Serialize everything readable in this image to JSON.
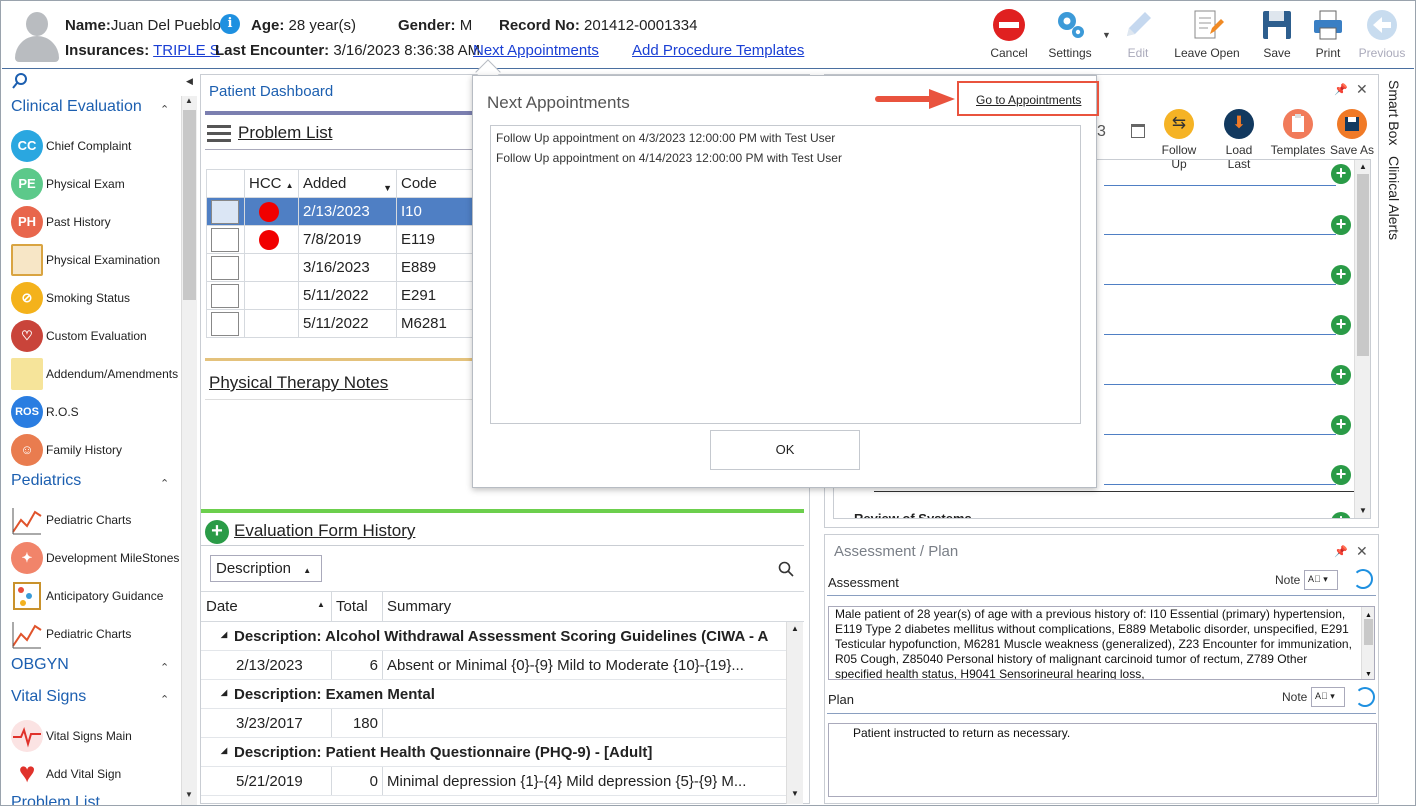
{
  "header": {
    "name_label": "Name:",
    "name_value": "Juan Del Pueblo",
    "age_label": "Age:",
    "age_value": "28 year(s)",
    "gender_label": "Gender:",
    "gender_value": "M",
    "record_label": "Record No:",
    "record_value": "201412-0001334",
    "insurances_label": "Insurances:",
    "insurances_value": "TRIPLE S",
    "last_encounter_label": "Last Encounter:",
    "last_encounter_value": "3/16/2023 8:36:38 AM",
    "next_appointments": "Next Appointments",
    "add_procedure_templates": "Add Procedure Templates"
  },
  "toolbar": {
    "cancel": "Cancel",
    "settings": "Settings",
    "edit": "Edit",
    "leave_open": "Leave Open",
    "save": "Save",
    "print": "Print",
    "previous": "Previous"
  },
  "leftnav": {
    "sections": {
      "clinical_evaluation": "Clinical Evaluation",
      "pediatrics": "Pediatrics",
      "obgyn": "OBGYN",
      "vital_signs": "Vital Signs",
      "problem_list": "Problem List"
    },
    "items": {
      "chief_complaint": {
        "label": "Chief Complaint",
        "badge": "CC"
      },
      "physical_exam": {
        "label": "Physical Exam",
        "badge": "PE"
      },
      "past_history": {
        "label": "Past History",
        "badge": "PH"
      },
      "physical_examination": {
        "label": "Physical Examination"
      },
      "smoking_status": {
        "label": "Smoking Status"
      },
      "custom_evaluation": {
        "label": "Custom Evaluation"
      },
      "addendum": {
        "label": "Addendum/Amendments"
      },
      "ros": {
        "label": "R.O.S",
        "badge": "ROS"
      },
      "family_history": {
        "label": "Family History"
      },
      "pediatric_charts_1": {
        "label": "Pediatric Charts"
      },
      "development_milestones": {
        "label": "Development MileStones"
      },
      "anticipatory_guidance": {
        "label": "Anticipatory Guidance"
      },
      "pediatric_charts_2": {
        "label": "Pediatric Charts"
      },
      "vital_signs_main": {
        "label": "Vital Signs Main"
      },
      "add_vital_sign": {
        "label": "Add Vital Sign"
      }
    }
  },
  "dashboard": {
    "title": "Patient Dashboard",
    "problem_list": {
      "title": "Problem List",
      "columns": {
        "hcc": "HCC",
        "added": "Added",
        "code": "Code"
      },
      "rows": [
        {
          "added": "2/13/2023",
          "code": "I10"
        },
        {
          "added": "7/8/2019",
          "code": "E119"
        },
        {
          "added": "3/16/2023",
          "code": "E889"
        },
        {
          "added": "5/11/2022",
          "code": "E291"
        },
        {
          "added": "5/11/2022",
          "code": "M6281"
        }
      ]
    },
    "physical_therapy_notes": "Physical Therapy Notes",
    "evaluation_history": {
      "title": "Evaluation Form History",
      "group_by": "Description",
      "columns": {
        "date": "Date",
        "total": "Total",
        "summary": "Summary"
      },
      "groups": [
        {
          "header": "Description: Alcohol Withdrawal Assessment Scoring Guidelines (CIWA - A",
          "date": "2/13/2023",
          "total": "6",
          "summary": "Absent or Minimal {0}-{9}  Mild to Moderate {10}-{19}..."
        },
        {
          "header": "Description: Examen Mental",
          "date": "3/23/2017",
          "total": "180",
          "summary": ""
        },
        {
          "header": "Description: Patient Health Questionnaire (PHQ-9) - [Adult]",
          "date": "5/21/2019",
          "total": "0",
          "summary": "Minimal depression {1}-{4}  Mild depression {5}-{9}  M..."
        }
      ]
    }
  },
  "right_panel": {
    "date_fragment": "3",
    "buttons": {
      "follow_up": "Follow Up",
      "load_last": "Load Last",
      "templates": "Templates",
      "save_as": "Save As"
    },
    "cut_label": "Review of Systems"
  },
  "assessment_plan": {
    "title": "Assessment / Plan",
    "assessment_label": "Assessment",
    "note_label": "Note",
    "assessment_text": "Male patient of 28 year(s) of age  with a previous history of: I10 Essential (primary) hypertension, E119 Type 2 diabetes mellitus without complications, E889 Metabolic disorder, unspecified, E291 Testicular hypofunction, M6281 Muscle weakness (generalized), Z23 Encounter for immunization, R05 Cough, Z85040 Personal history of malignant carcinoid tumor of rectum, Z789 Other specified health status, H9041 Sensorineural hearing loss,",
    "plan_label": "Plan",
    "plan_text": "Patient instructed to return as necessary."
  },
  "side_tabs": {
    "smart_box": "Smart Box",
    "clinical_alerts": "Clinical Alerts"
  },
  "modal": {
    "title": "Next Appointments",
    "go_to": "Go to Appointments",
    "appointments": [
      "Follow Up appointment on 4/3/2023 12:00:00 PM with Test User",
      "Follow Up appointment on 4/14/2023 12:00:00 PM with Test User"
    ],
    "ok": "OK"
  },
  "colors": {
    "accent": "#1c5fb0",
    "selection": "#4f7fc4",
    "callout": "#e9533e",
    "hcc_dot": "#f10000",
    "add_green": "#2a9b47"
  }
}
